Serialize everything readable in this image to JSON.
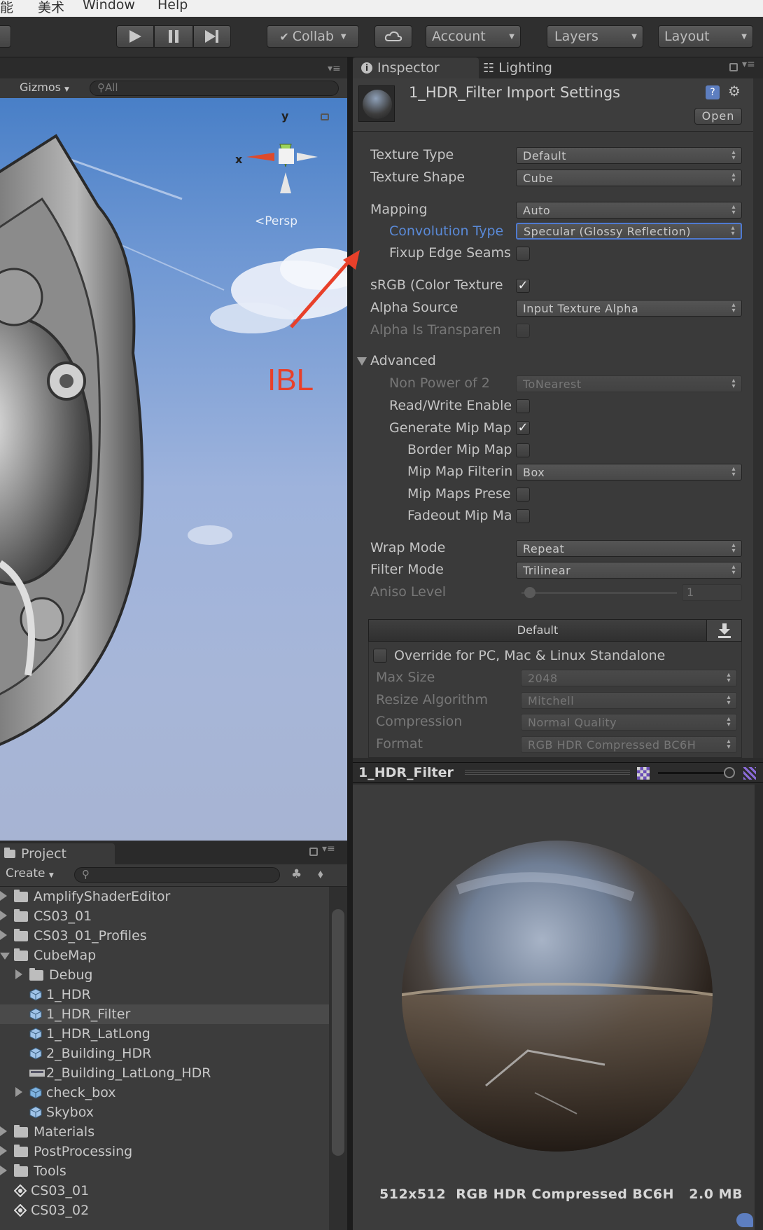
{
  "menu": [
    "能",
    "美术",
    "Window",
    "Help"
  ],
  "toolbar": {
    "collab": "Collab",
    "account": "Account",
    "layers": "Layers",
    "layout": "Layout"
  },
  "scene": {
    "gizmos": "Gizmos",
    "search_placeholder": "All",
    "axis_x": "x",
    "axis_y": "y",
    "persp": "Persp"
  },
  "annotation": {
    "text": "IBL",
    "color": "#e8402a"
  },
  "inspector": {
    "tabs": [
      "Inspector",
      "Lighting"
    ],
    "title": "1_HDR_Filter Import Settings",
    "open_button": "Open",
    "rows": {
      "texture_type": {
        "label": "Texture Type",
        "value": "Default"
      },
      "texture_shape": {
        "label": "Texture Shape",
        "value": "Cube"
      },
      "mapping": {
        "label": "Mapping",
        "value": "Auto"
      },
      "convolution_type": {
        "label": "Convolution Type",
        "value": "Specular (Glossy Reflection)"
      },
      "fixup_edge": {
        "label": "Fixup Edge Seams"
      },
      "srgb": {
        "label": "sRGB (Color Texture"
      },
      "alpha_source": {
        "label": "Alpha Source",
        "value": "Input Texture Alpha"
      },
      "alpha_transparency": {
        "label": "Alpha Is Transparen"
      },
      "advanced": {
        "label": "Advanced"
      },
      "non_power": {
        "label": "Non Power of 2",
        "value": "ToNearest"
      },
      "read_write": {
        "label": "Read/Write Enable"
      },
      "gen_mip": {
        "label": "Generate Mip Map"
      },
      "border_mip": {
        "label": "Border Mip Map"
      },
      "mip_filter": {
        "label": "Mip Map Filterin",
        "value": "Box"
      },
      "mip_preserve": {
        "label": "Mip Maps Prese"
      },
      "fadeout_mip": {
        "label": "Fadeout Mip Ma"
      },
      "wrap_mode": {
        "label": "Wrap Mode",
        "value": "Repeat"
      },
      "filter_mode": {
        "label": "Filter Mode",
        "value": "Trilinear"
      },
      "aniso_level": {
        "label": "Aniso Level",
        "value": "1"
      }
    },
    "platform": {
      "tab_default": "Default",
      "override": "Override for PC, Mac & Linux Standalone",
      "max_size": {
        "label": "Max Size",
        "value": "2048"
      },
      "resize": {
        "label": "Resize Algorithm",
        "value": "Mitchell"
      },
      "compression": {
        "label": "Compression",
        "value": "Normal Quality"
      },
      "format": {
        "label": "Format",
        "value": "RGB HDR Compressed BC6H"
      }
    }
  },
  "preview": {
    "title": "1_HDR_Filter",
    "info": "512x512  RGB HDR Compressed BC6H   2.0 MB"
  },
  "project": {
    "tab": "Project",
    "create": "Create",
    "items": [
      {
        "label": "AmplifyShaderEditor",
        "type": "folder",
        "indent": 0,
        "expand": "right"
      },
      {
        "label": "CS03_01",
        "type": "folder",
        "indent": 0,
        "expand": "right"
      },
      {
        "label": "CS03_01_Profiles",
        "type": "folder",
        "indent": 0,
        "expand": "right"
      },
      {
        "label": "CubeMap",
        "type": "folder",
        "indent": 0,
        "expand": "down"
      },
      {
        "label": "Debug",
        "type": "folder",
        "indent": 1,
        "expand": "right"
      },
      {
        "label": "1_HDR",
        "type": "cube",
        "indent": 1
      },
      {
        "label": "1_HDR_Filter",
        "type": "cube",
        "indent": 1,
        "selected": true
      },
      {
        "label": "1_HDR_LatLong",
        "type": "cube",
        "indent": 1
      },
      {
        "label": "2_Building_HDR",
        "type": "cube",
        "indent": 1
      },
      {
        "label": "2_Building_LatLong_HDR",
        "type": "image",
        "indent": 1
      },
      {
        "label": "check_box",
        "type": "prefab",
        "indent": 1,
        "expand": "right"
      },
      {
        "label": "Skybox",
        "type": "cube",
        "indent": 1
      },
      {
        "label": "Materials",
        "type": "folder",
        "indent": 0,
        "expand": "right"
      },
      {
        "label": "PostProcessing",
        "type": "folder",
        "indent": 0,
        "expand": "right"
      },
      {
        "label": "Tools",
        "type": "folder",
        "indent": 0,
        "expand": "right"
      },
      {
        "label": "CS03_01",
        "type": "unity",
        "indent": 0
      },
      {
        "label": "CS03_02",
        "type": "unity",
        "indent": 0
      }
    ]
  }
}
